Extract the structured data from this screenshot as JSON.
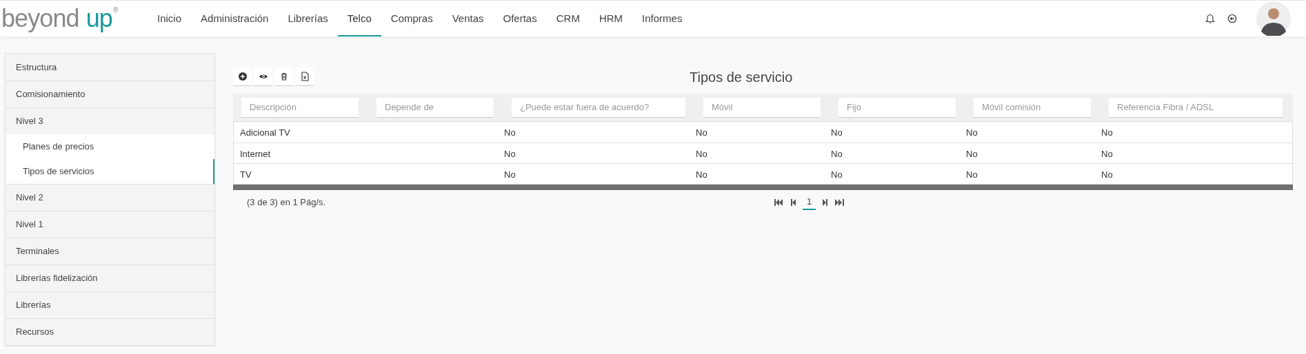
{
  "logo": {
    "word_1": "beyond",
    "word_2": "up",
    "mark": "®"
  },
  "nav": [
    {
      "label": "Inicio",
      "selected": false
    },
    {
      "label": "Administración",
      "selected": false
    },
    {
      "label": "Librerías",
      "selected": false
    },
    {
      "label": "Telco",
      "selected": true
    },
    {
      "label": "Compras",
      "selected": false
    },
    {
      "label": "Ventas",
      "selected": false
    },
    {
      "label": "Ofertas",
      "selected": false
    },
    {
      "label": "CRM",
      "selected": false
    },
    {
      "label": "HRM",
      "selected": false
    },
    {
      "label": "Informes",
      "selected": false
    }
  ],
  "sidebar": {
    "items": [
      {
        "label": "Estructura"
      },
      {
        "label": "Comisionamiento"
      },
      {
        "label": "Nivel 3",
        "children": [
          {
            "label": "Planes de precios",
            "selected": false
          },
          {
            "label": "Tipos de servicios",
            "selected": true
          }
        ]
      },
      {
        "label": "Nivel 2"
      },
      {
        "label": "Nivel 1"
      },
      {
        "label": "Terminales"
      },
      {
        "label": "Librerías fidelización"
      },
      {
        "label": "Librerías"
      },
      {
        "label": "Recursos"
      }
    ]
  },
  "toolbar": [
    {
      "kind": "add"
    },
    {
      "kind": "view"
    },
    {
      "kind": "delete"
    },
    {
      "kind": "excel"
    }
  ],
  "title": "Tipos de servicio",
  "table": {
    "filters": [
      {
        "placeholder": "Descripción"
      },
      {
        "placeholder": "Depende de"
      },
      {
        "placeholder": "¿Puede estar fuera de acuerdo?"
      },
      {
        "placeholder": "Móvil"
      },
      {
        "placeholder": "Fijo"
      },
      {
        "placeholder": "Móvil comisión"
      },
      {
        "placeholder": "Referencia Fibra / ADSL"
      }
    ],
    "rows": [
      [
        "Adicional TV",
        null,
        "No",
        "No",
        "No",
        "No",
        "No"
      ],
      [
        "Internet",
        null,
        "No",
        "No",
        "No",
        "No",
        "No"
      ],
      [
        "TV",
        null,
        "No",
        "No",
        "No",
        "No",
        "No"
      ]
    ]
  },
  "pager": {
    "summary": "(3 de 3) en 1 Pág/s.",
    "pages": [
      {
        "label": "1",
        "selected": true
      }
    ]
  }
}
